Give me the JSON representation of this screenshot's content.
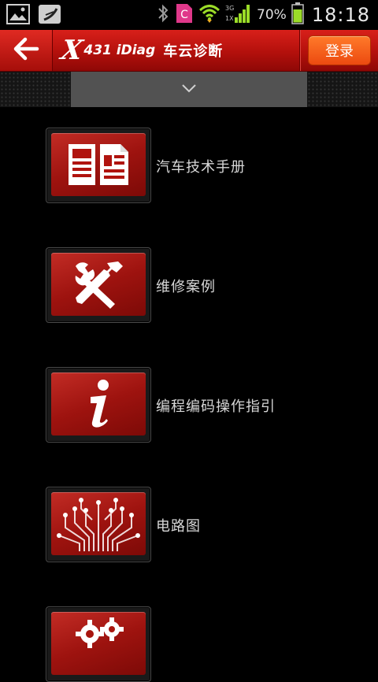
{
  "status_bar": {
    "battery_percent": "70%",
    "time": "18:18",
    "network_top": "3G",
    "network_bottom": "1X",
    "notification_app_letter": "C",
    "icons": [
      "gallery-icon",
      "music-note-icon",
      "c-app-icon",
      "bluetooth-icon",
      "wifi-icon",
      "signal-icon",
      "battery-icon"
    ]
  },
  "header": {
    "logo_mark": "X",
    "logo_brand": "431 iDiag",
    "logo_title": "车云诊断",
    "login_label": "登录",
    "back_icon": "arrow-left-icon"
  },
  "dropdown": {
    "icon": "chevron-down-icon"
  },
  "menu": {
    "items": [
      {
        "label": "汽车技术手册",
        "icon": "manual-book-icon"
      },
      {
        "label": "维修案例",
        "icon": "wrench-screwdriver-icon"
      },
      {
        "label": "编程编码操作指引",
        "icon": "info-icon"
      },
      {
        "label": "电路图",
        "icon": "circuit-icon"
      },
      {
        "label": "",
        "icon": "gears-icon"
      }
    ]
  },
  "colors": {
    "header_red": "#c8150f",
    "login_orange": "#f25a18",
    "tile_red": "#a8160f",
    "background": "#000000"
  }
}
